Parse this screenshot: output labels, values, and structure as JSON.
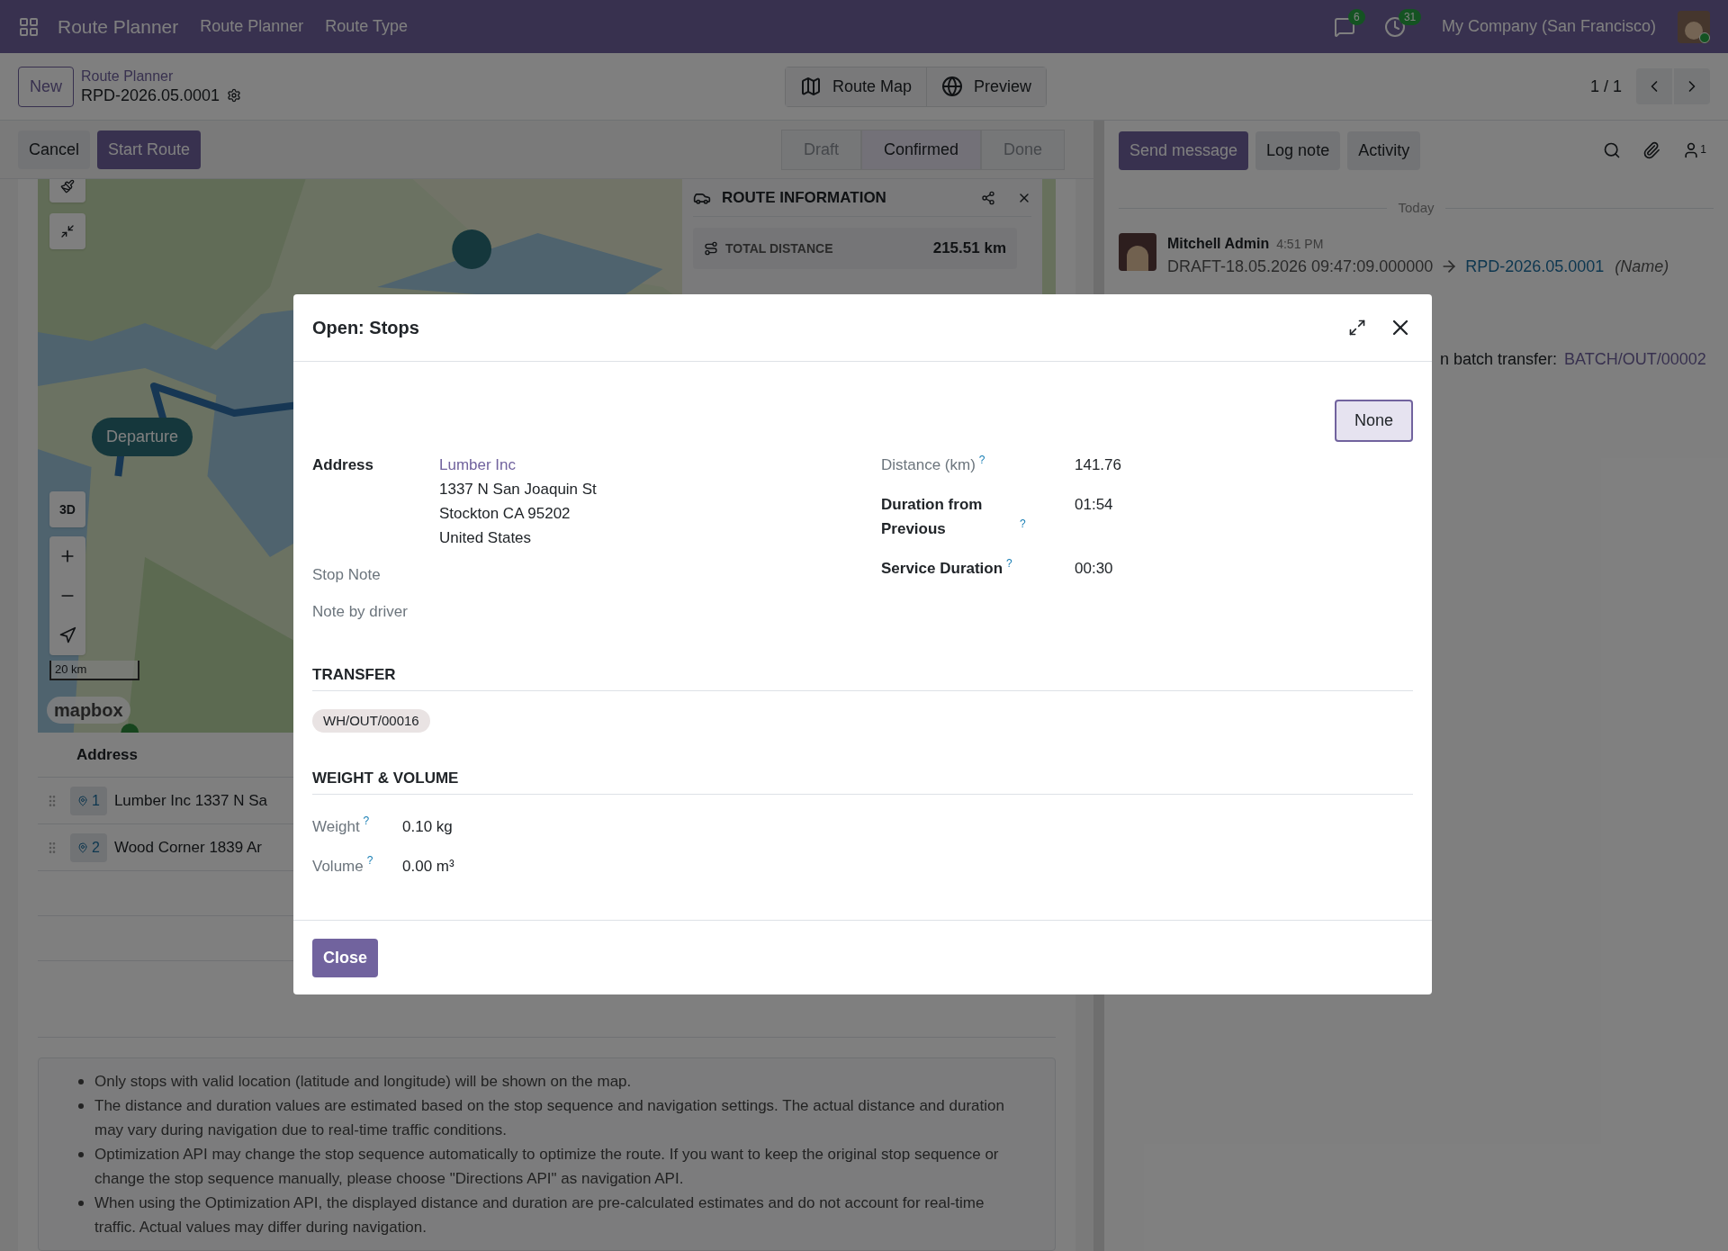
{
  "navbar": {
    "brand": "Route Planner",
    "menus": [
      "Route Planner",
      "Route Type"
    ],
    "messages_badge": "6",
    "activities_badge": "31",
    "company": "My Company (San Francisco)"
  },
  "control_panel": {
    "new_button": "New",
    "breadcrumb": "Route Planner",
    "record": "RPD-2026.05.0001",
    "views": [
      {
        "label": "Route Map"
      },
      {
        "label": "Preview"
      }
    ],
    "pager": "1 / 1"
  },
  "actions": [
    {
      "label": "Cancel",
      "kind": "secondary"
    },
    {
      "label": "Start Route",
      "kind": "primary"
    }
  ],
  "statusbar": [
    {
      "label": "Draft",
      "selected": false
    },
    {
      "label": "Confirmed",
      "selected": true
    },
    {
      "label": "Done",
      "selected": false
    }
  ],
  "map": {
    "three_d": "3D",
    "scale": "20 km",
    "attribution": "mapbox",
    "departure": "Departure",
    "route_info": {
      "title": "ROUTE INFORMATION",
      "metrics": [
        {
          "label": "TOTAL DISTANCE",
          "value": "215.51 km"
        }
      ]
    }
  },
  "stops_table": {
    "columns": [
      "Address"
    ],
    "rows": [
      {
        "sequence": "1",
        "address": "Lumber Inc 1337 N Sa"
      },
      {
        "sequence": "2",
        "address": "Wood Corner 1839 Ar"
      }
    ]
  },
  "notes": [
    "Only stops with valid location (latitude and longitude) will be shown on the map.",
    "The distance and duration values are estimated based on the stop sequence and navigation settings. The actual distance and duration may vary during navigation due to real-time traffic conditions.",
    "Optimization API may change the stop sequence automatically to optimize the route. If you want to keep the original stop sequence or change the stop sequence manually, please choose \"Directions API\" as navigation API.",
    "When using the Optimization API, the displayed distance and duration are pre-calculated estimates and do not account for real-time traffic. Actual values may differ during navigation."
  ],
  "chatter": {
    "buttons": [
      {
        "label": "Send message",
        "kind": "primary"
      },
      {
        "label": "Log note",
        "kind": "secondary"
      },
      {
        "label": "Activity",
        "kind": "secondary"
      }
    ],
    "followers": "1",
    "date_separator": "Today",
    "messages": [
      {
        "author": "Mitchell Admin",
        "time": "4:51 PM",
        "old_value": "DRAFT-18.05.2026 09:47:09.000000",
        "new_value": "RPD-2026.05.0001",
        "field": "(Name)"
      }
    ],
    "partial_line": {
      "text": "n batch transfer:",
      "link": "BATCH/OUT/00002"
    }
  },
  "dialog": {
    "title": "Open: Stops",
    "top_button": "None",
    "left_fields": [
      {
        "label": "Address",
        "muted": false,
        "link": "Lumber Inc",
        "lines": [
          "1337 N San Joaquin St",
          "Stockton CA 95202",
          "United States"
        ]
      },
      {
        "label": "Stop Note",
        "muted": true
      },
      {
        "label": "Note by driver",
        "muted": true
      }
    ],
    "right_fields": [
      {
        "label": "Distance (km)",
        "help": "?",
        "muted": true,
        "value": "141.76"
      },
      {
        "label": "Duration from Previous",
        "help": "?",
        "muted": false,
        "value": "01:54"
      },
      {
        "label": "Service Duration",
        "help": "?",
        "muted": false,
        "value": "00:30"
      }
    ],
    "transfer": {
      "title": "TRANSFER",
      "tags": [
        "WH/OUT/00016"
      ]
    },
    "weight_volume": {
      "title": "WEIGHT & VOLUME",
      "fields": [
        {
          "label": "Weight",
          "help": "?",
          "value": "0.10 kg"
        },
        {
          "label": "Volume",
          "help": "?",
          "value": "0.00 m³"
        }
      ]
    },
    "footer_button": "Close"
  }
}
